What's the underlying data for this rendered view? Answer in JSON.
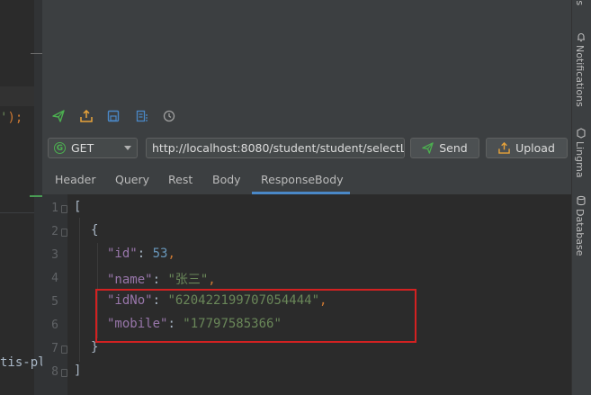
{
  "left_editor": {
    "paren_text": "');",
    "tail_text": "tis-pl"
  },
  "toolbar": {
    "icons": [
      "send-icon",
      "export-icon",
      "save-icon",
      "list-icon",
      "history-icon"
    ]
  },
  "request": {
    "method": "GET",
    "method_icon_letter": "G",
    "url": "http://localhost:8080/student/student/selectList",
    "send_label": "Send",
    "upload_label": "Upload"
  },
  "tabs": [
    {
      "label": "Header"
    },
    {
      "label": "Query"
    },
    {
      "label": "Rest"
    },
    {
      "label": "Body"
    },
    {
      "label": "ResponseBody",
      "active": true
    }
  ],
  "response": {
    "line_numbers": [
      "1",
      "2",
      "3",
      "4",
      "5",
      "6",
      "7",
      "8"
    ],
    "open_bracket": "[",
    "open_brace": "{",
    "fields": [
      {
        "key": "\"id\"",
        "value": "53"
      },
      {
        "key": "\"name\"",
        "value": "\"张三\""
      },
      {
        "key": "\"idNo\"",
        "value": "\"620422199707054444\""
      },
      {
        "key": "\"mobile\"",
        "value": "\"17797585366\""
      }
    ],
    "close_brace": "}",
    "close_bracket": "]"
  },
  "sidebar": {
    "top_label": "ts",
    "items": [
      {
        "label": "Notifications",
        "icon": "bell-icon"
      },
      {
        "label": "Lingma",
        "icon": "lingma-icon"
      },
      {
        "label": "Database",
        "icon": "database-icon"
      }
    ]
  },
  "colors": {
    "accent": "#4a88c7",
    "highlight_box": "#d32121",
    "string": "#6a8759",
    "number": "#6897bb",
    "key": "#9876aa"
  }
}
